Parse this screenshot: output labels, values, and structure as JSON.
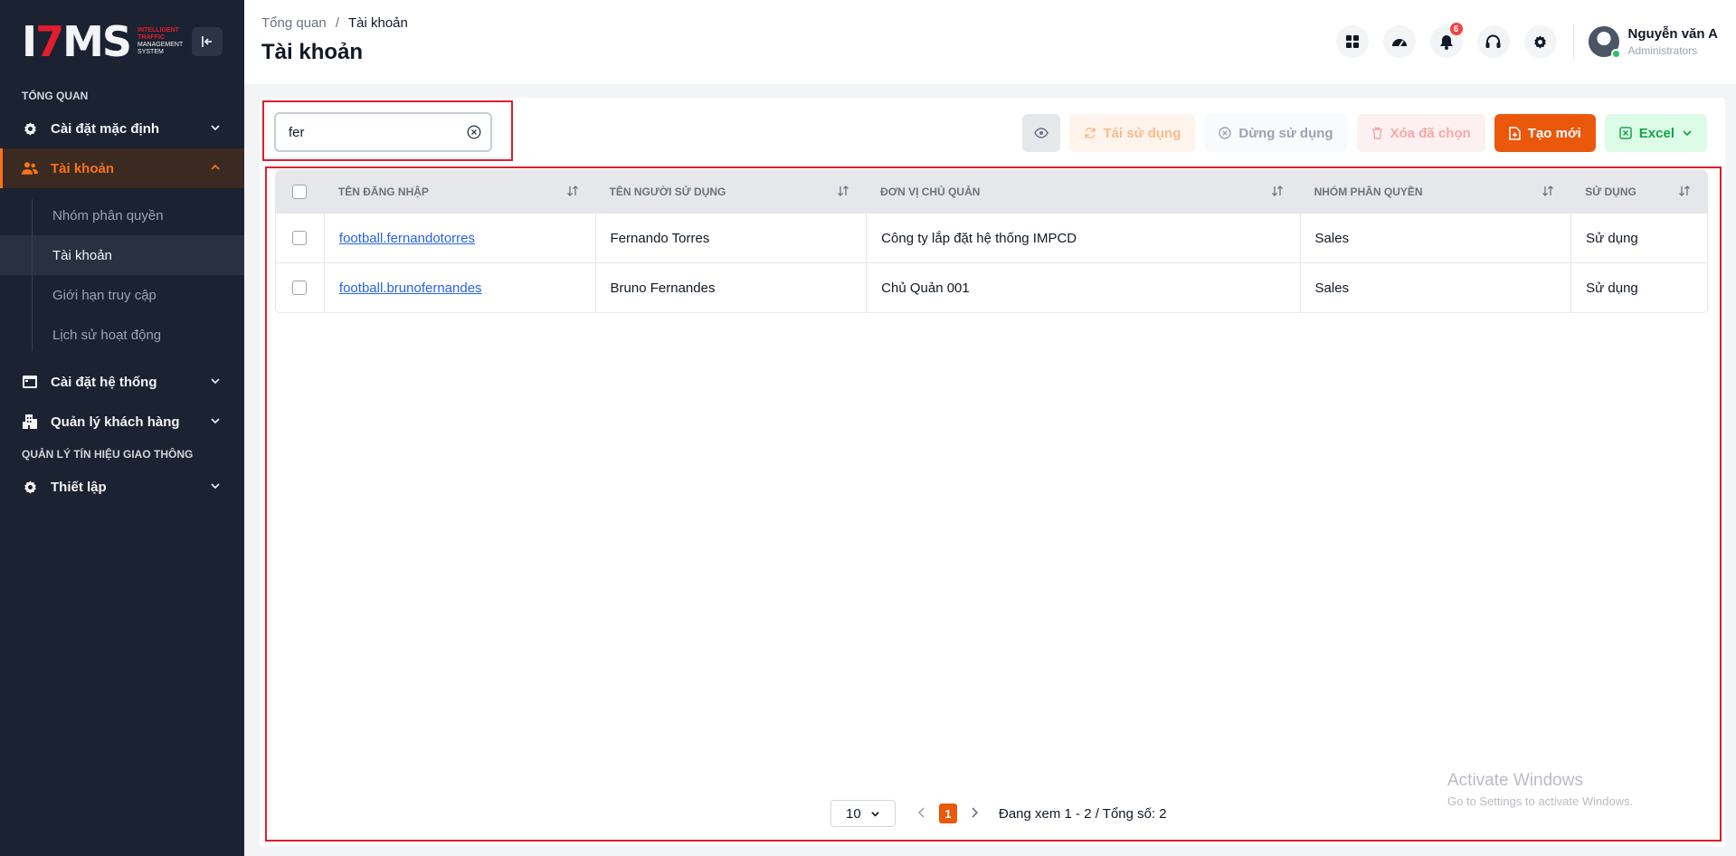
{
  "logo": {
    "mark": "ITMS",
    "subtitle_red": "INTELLIGENT TRAFFIC",
    "subtitle_white": "MANAGEMENT SYSTEM"
  },
  "sidebar": {
    "section_overview": "TỔNG QUAN",
    "items": [
      {
        "label": "Cài đặt mặc định",
        "icon": "gear-icon"
      },
      {
        "label": "Tài khoản",
        "icon": "users-icon"
      }
    ],
    "sub_items": [
      {
        "label": "Nhóm phân quyền"
      },
      {
        "label": "Tài khoản"
      },
      {
        "label": "Giới hạn truy cập"
      },
      {
        "label": "Lịch sử hoạt động"
      }
    ],
    "items2": [
      {
        "label": "Cài đặt hệ thống",
        "icon": "calendar-icon"
      },
      {
        "label": "Quản lý khách hàng",
        "icon": "building-icon"
      }
    ],
    "section_traffic": "QUẢN LÝ TÍN HIỆU GIAO THÔNG",
    "items3": [
      {
        "label": "Thiết lập",
        "icon": "gear-icon"
      }
    ]
  },
  "header": {
    "breadcrumb_root": "Tổng quan",
    "breadcrumb_sep": "/",
    "breadcrumb_current": "Tài khoản",
    "title": "Tài khoản",
    "notification_count": "6",
    "user_name": "Nguyễn văn A",
    "user_role": "Administrators"
  },
  "search": {
    "value": "fer"
  },
  "toolbar": {
    "reuse_label": "Tái sử dụng",
    "stop_label": "Dừng sử dụng",
    "delete_label": "Xóa đã chọn",
    "create_label": "Tạo mới",
    "excel_label": "Excel"
  },
  "table": {
    "headers": [
      "TÊN ĐĂNG NHẬP",
      "TÊN NGƯỜI SỬ DỤNG",
      "ĐƠN VỊ CHỦ QUẢN",
      "NHÓM PHÂN QUYỀN",
      "SỬ DỤNG"
    ],
    "rows": [
      {
        "username": "football.fernandotorres",
        "fullname": "Fernando Torres",
        "unit": "Công ty lắp đặt hệ thống IMPCD",
        "group": "Sales",
        "status": "Sử dụng"
      },
      {
        "username": "football.brunofernandes",
        "fullname": "Bruno Fernandes",
        "unit": "Chủ Quản 001",
        "group": "Sales",
        "status": "Sử dụng"
      }
    ]
  },
  "pagination": {
    "page_size": "10",
    "current_page": "1",
    "info": "Đang xem 1 - 2 / Tổng số: 2"
  },
  "watermark": {
    "line1": "Activate Windows",
    "line2": "Go to Settings to activate Windows."
  },
  "colors": {
    "accent": "#ea580c",
    "sidebar_bg": "#1b2232",
    "highlight": "#e11d2e",
    "excel": "#16a34a"
  }
}
